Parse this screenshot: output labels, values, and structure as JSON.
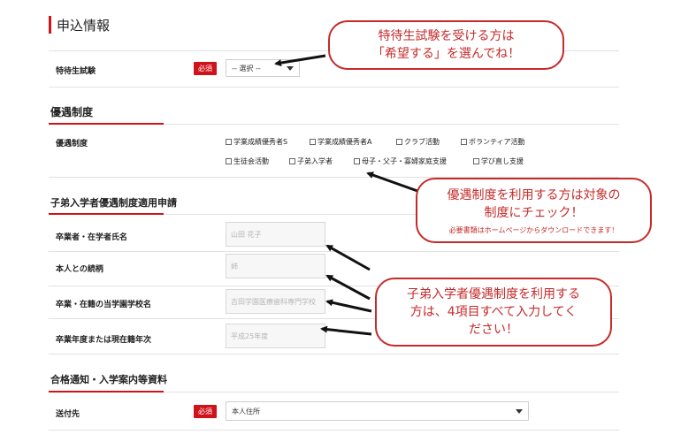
{
  "sections": {
    "application_info": "申込情報",
    "preferential": "優遇制度",
    "child_enrollment": "子弟入学者優遇制度適用申請",
    "acceptance_materials": "合格通知・入学案内等資料"
  },
  "exam": {
    "label": "特待生試験",
    "required": "必須",
    "value": "-- 選択 --"
  },
  "preferential": {
    "label": "優遇制度",
    "options": [
      "学業成績優秀者S",
      "学業成績優秀者A",
      "クラブ活動",
      "ボランティア活動",
      "生徒会活動",
      "子弟入学者",
      "母子・父子・寡婦家庭支援",
      "学び直し支援"
    ]
  },
  "child_fields": [
    {
      "label": "卒業者・在学者氏名",
      "placeholder": "山田 花子"
    },
    {
      "label": "本人との続柄",
      "placeholder": "姉"
    },
    {
      "label": "卒業・在籍の当学園学校名",
      "placeholder": "吉田学園医療歯科専門学校"
    },
    {
      "label": "卒業年度または現在籍年次",
      "placeholder": "平成25年度"
    }
  ],
  "delivery": {
    "label": "送付先",
    "required": "必須",
    "value": "本人住所"
  },
  "callouts": {
    "exam_line1": "特待生試験を受ける方は",
    "exam_line2": "「希望する」を選んでね！",
    "pref_line1": "優遇制度を利用する方は対象の",
    "pref_line2": "制度にチェック！",
    "pref_note": "必要書類はホームページからダウンロードできます！",
    "child_line1": "子弟入学者優遇制度を利用する",
    "child_line2": "方は、4項目すべて入力してく",
    "child_line3": "ださい！"
  },
  "colors": {
    "accent": "#d0121b",
    "callout": "#c62a2a"
  }
}
